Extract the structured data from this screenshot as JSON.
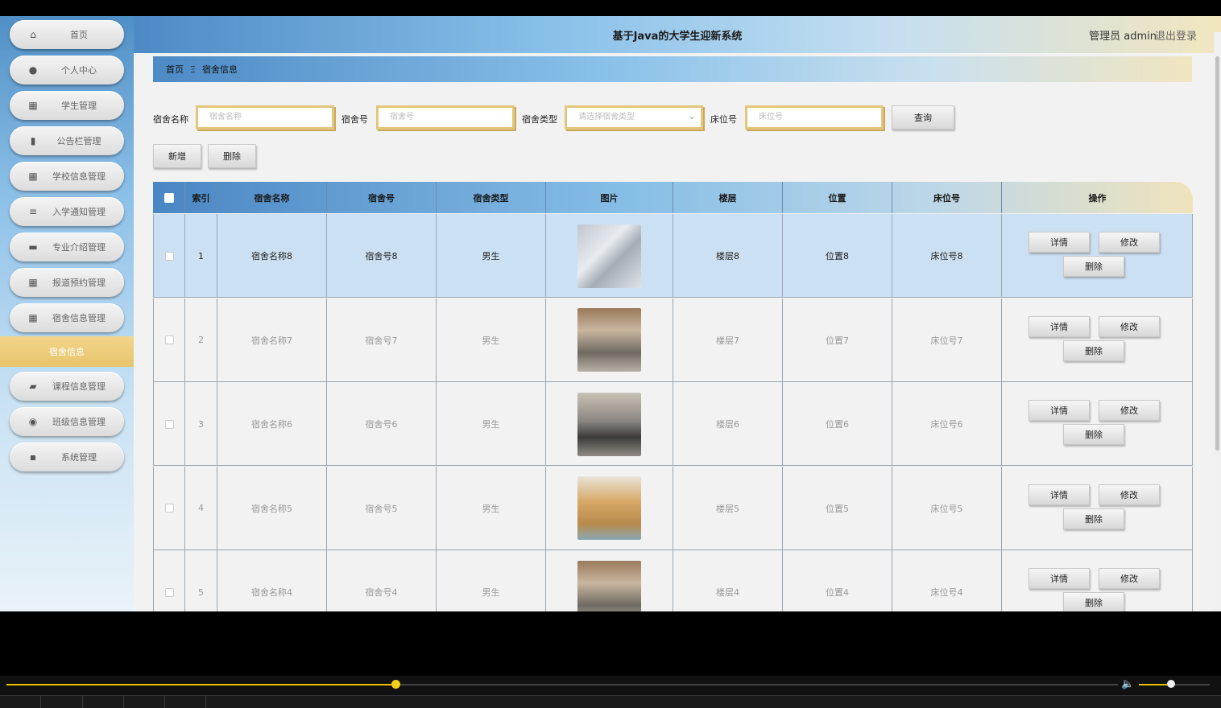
{
  "header": {
    "title": "基于Java的大学生迎新系统",
    "admin": "管理员 admin",
    "logout": "退出登录"
  },
  "sidebar": {
    "items": [
      {
        "label": "首页",
        "icon": "home-icon"
      },
      {
        "label": "个人中心",
        "icon": "user-icon"
      },
      {
        "label": "学生管理",
        "icon": "grid-icon"
      },
      {
        "label": "公告栏管理",
        "icon": "chart-icon"
      },
      {
        "label": "学校信息管理",
        "icon": "grid-icon"
      },
      {
        "label": "入学通知管理",
        "icon": "list-icon"
      },
      {
        "label": "专业介绍管理",
        "icon": "briefcase-icon"
      },
      {
        "label": "报道预约管理",
        "icon": "grid-icon"
      },
      {
        "label": "宿舍信息管理",
        "icon": "grid-icon"
      },
      {
        "label": "课程信息管理",
        "icon": "wallet-icon"
      },
      {
        "label": "班级信息管理",
        "icon": "pin-icon"
      },
      {
        "label": "系统管理",
        "icon": "chat-icon"
      }
    ],
    "active_sub": "宿舍信息"
  },
  "breadcrumb": {
    "home": "首页",
    "sep": "Ξ",
    "current": "宿舍信息"
  },
  "search": {
    "name_label": "宿舍名称",
    "name_placeholder": "宿舍名称",
    "no_label": "宿舍号",
    "no_placeholder": "宿舍号",
    "type_label": "宿舍类型",
    "type_placeholder": "请选择宿舍类型",
    "bed_label": "床位号",
    "bed_placeholder": "床位号",
    "query_btn": "查询"
  },
  "actions": {
    "add": "新增",
    "delete": "删除"
  },
  "table": {
    "columns": [
      "索引",
      "宿舍名称",
      "宿舍号",
      "宿舍类型",
      "图片",
      "楼层",
      "位置",
      "床位号",
      "操作"
    ],
    "rows": [
      {
        "idx": "1",
        "name": "宿舍名称8",
        "no": "宿舍号8",
        "type": "男生",
        "floor": "楼层8",
        "pos": "位置8",
        "bed": "床位号8"
      },
      {
        "idx": "2",
        "name": "宿舍名称7",
        "no": "宿舍号7",
        "type": "男生",
        "floor": "楼层7",
        "pos": "位置7",
        "bed": "床位号7"
      },
      {
        "idx": "3",
        "name": "宿舍名称6",
        "no": "宿舍号6",
        "type": "男生",
        "floor": "楼层6",
        "pos": "位置6",
        "bed": "床位号6"
      },
      {
        "idx": "4",
        "name": "宿舍名称5",
        "no": "宿舍号5",
        "type": "男生",
        "floor": "楼层5",
        "pos": "位置5",
        "bed": "床位号5"
      },
      {
        "idx": "5",
        "name": "宿舍名称4",
        "no": "宿舍号4",
        "type": "男生",
        "floor": "楼层4",
        "pos": "位置4",
        "bed": "床位号4"
      }
    ],
    "op_detail": "详情",
    "op_edit": "修改",
    "op_delete": "删除"
  },
  "player": {
    "progress": 0.35,
    "volume": 0.45
  }
}
